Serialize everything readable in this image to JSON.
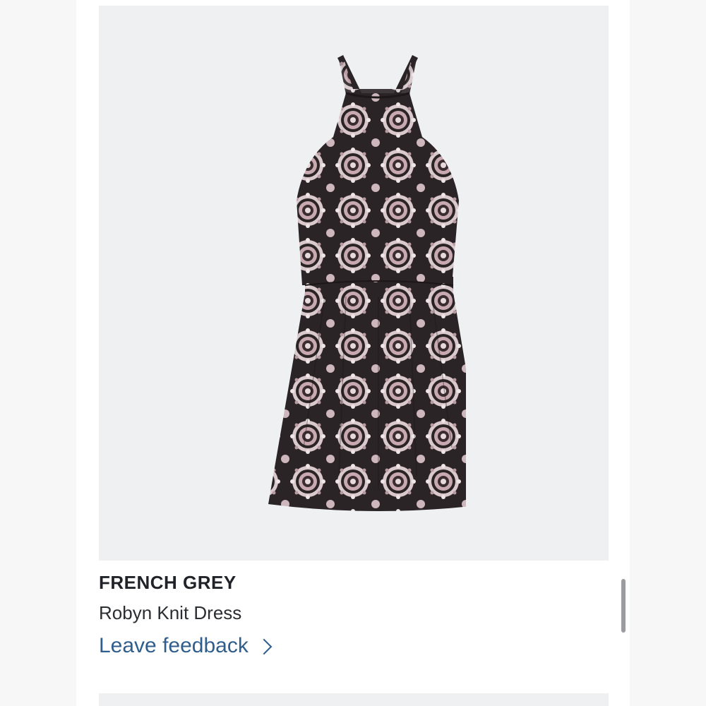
{
  "product": {
    "brand": "FRENCH GREY",
    "name": "Robyn Knit Dress",
    "image_icon": "dress-icon",
    "image_background": "#eef0f1"
  },
  "actions": {
    "feedback_label": "Leave feedback",
    "feedback_icon": "chevron-right-icon",
    "link_color": "#2f5e8d"
  }
}
